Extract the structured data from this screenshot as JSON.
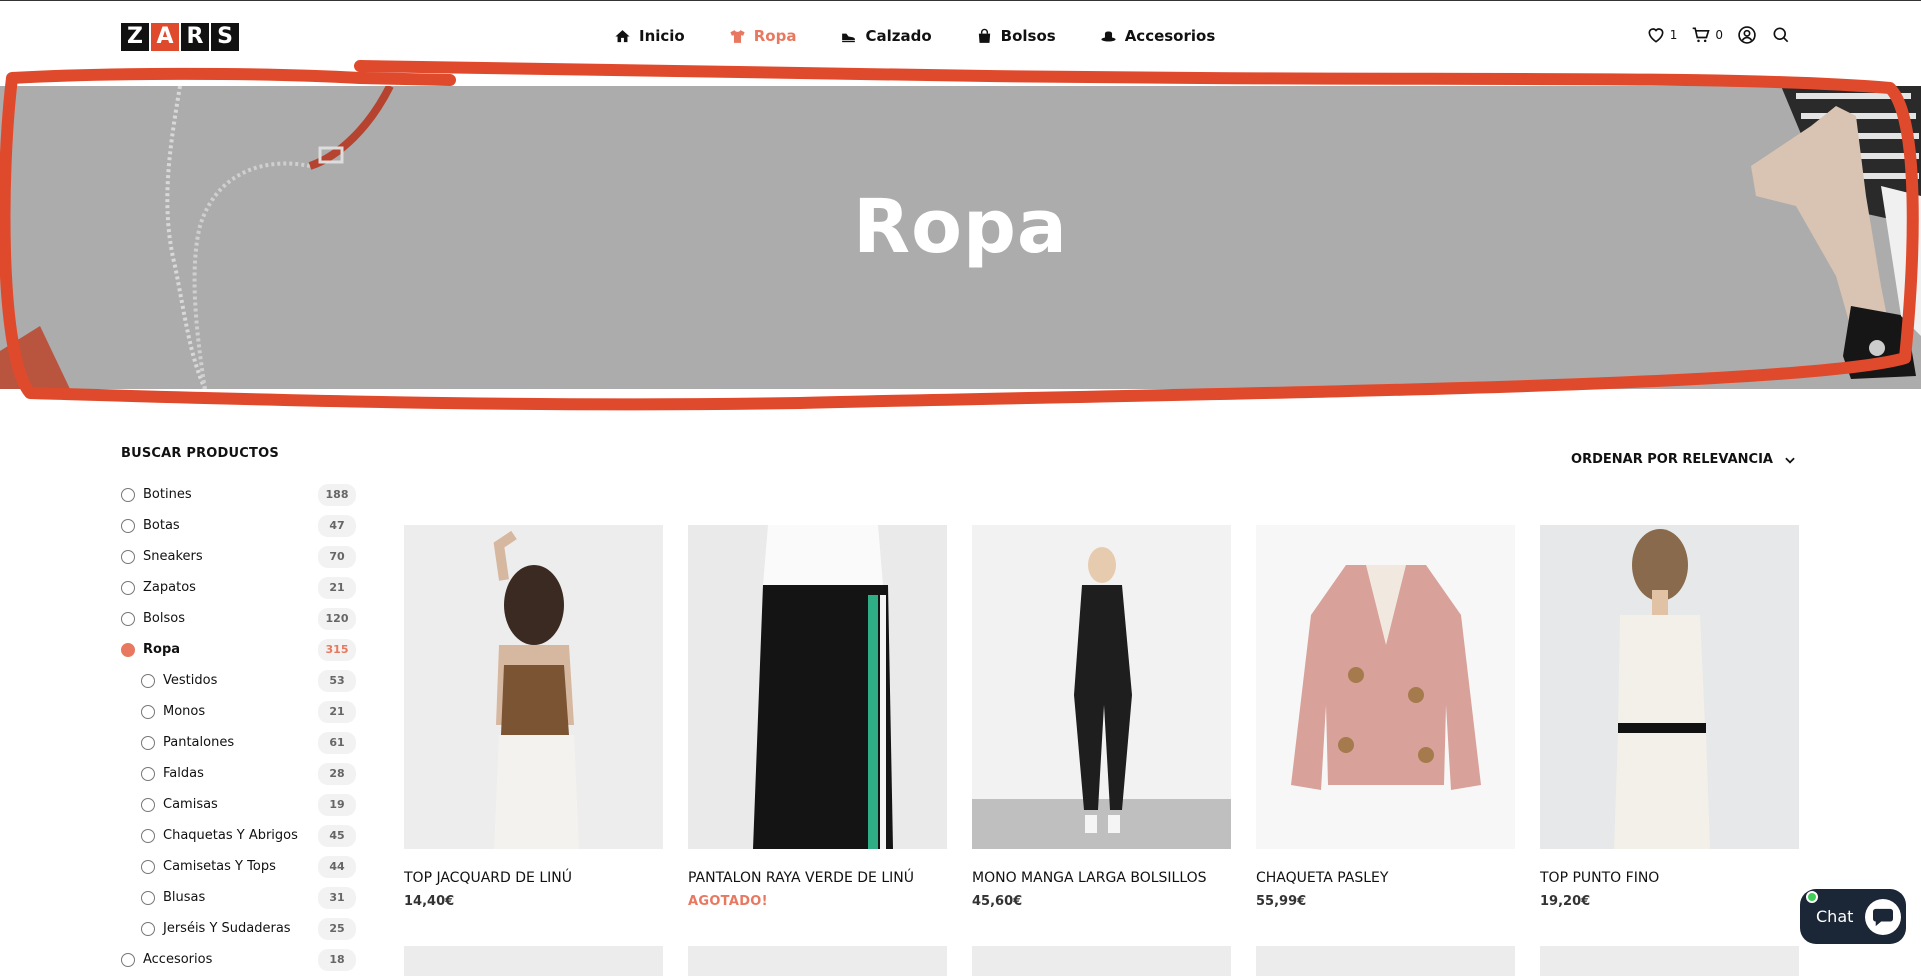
{
  "brand": {
    "letters": [
      "Z",
      "A",
      "R",
      "S"
    ],
    "accent": "#e8785f",
    "logo_red": "#e04a2c"
  },
  "nav": [
    {
      "label": "Inicio",
      "icon": "home-icon",
      "active": false
    },
    {
      "label": "Ropa",
      "icon": "tshirt-icon",
      "active": true
    },
    {
      "label": "Calzado",
      "icon": "shoe-icon",
      "active": false
    },
    {
      "label": "Bolsos",
      "icon": "bag-icon",
      "active": false
    },
    {
      "label": "Accesorios",
      "icon": "hat-icon",
      "active": false
    }
  ],
  "header_tools": {
    "wishlist_count": "1",
    "cart_count": "0"
  },
  "hero": {
    "title": "Ropa"
  },
  "sidebar": {
    "title": "BUSCAR PRODUCTOS",
    "filters": [
      {
        "label": "Botines",
        "count": "188"
      },
      {
        "label": "Botas",
        "count": "47"
      },
      {
        "label": "Sneakers",
        "count": "70"
      },
      {
        "label": "Zapatos",
        "count": "21"
      },
      {
        "label": "Bolsos",
        "count": "120"
      },
      {
        "label": "Ropa",
        "count": "315"
      },
      {
        "label": "Vestidos",
        "count": "53"
      },
      {
        "label": "Monos",
        "count": "21"
      },
      {
        "label": "Pantalones",
        "count": "61"
      },
      {
        "label": "Faldas",
        "count": "28"
      },
      {
        "label": "Camisas",
        "count": "19"
      },
      {
        "label": "Chaquetas Y Abrigos",
        "count": "45"
      },
      {
        "label": "Camisetas Y Tops",
        "count": "44"
      },
      {
        "label": "Blusas",
        "count": "31"
      },
      {
        "label": "Jerséis Y Sudaderas",
        "count": "25"
      },
      {
        "label": "Accesorios",
        "count": "18"
      }
    ]
  },
  "sort": {
    "label": "ORDENAR POR RELEVANCIA"
  },
  "products": [
    {
      "name": "TOP JACQUARD DE LINÚ",
      "price": "14,40€"
    },
    {
      "name": "PANTALON RAYA VERDE DE LINÚ",
      "price": "AGOTADO!"
    },
    {
      "name": "MONO MANGA LARGA BOLSILLOS",
      "price": "45,60€"
    },
    {
      "name": "CHAQUETA PASLEY",
      "price": "55,99€"
    },
    {
      "name": "TOP PUNTO FINO",
      "price": "19,20€"
    }
  ],
  "chat": {
    "label": "Chat"
  }
}
